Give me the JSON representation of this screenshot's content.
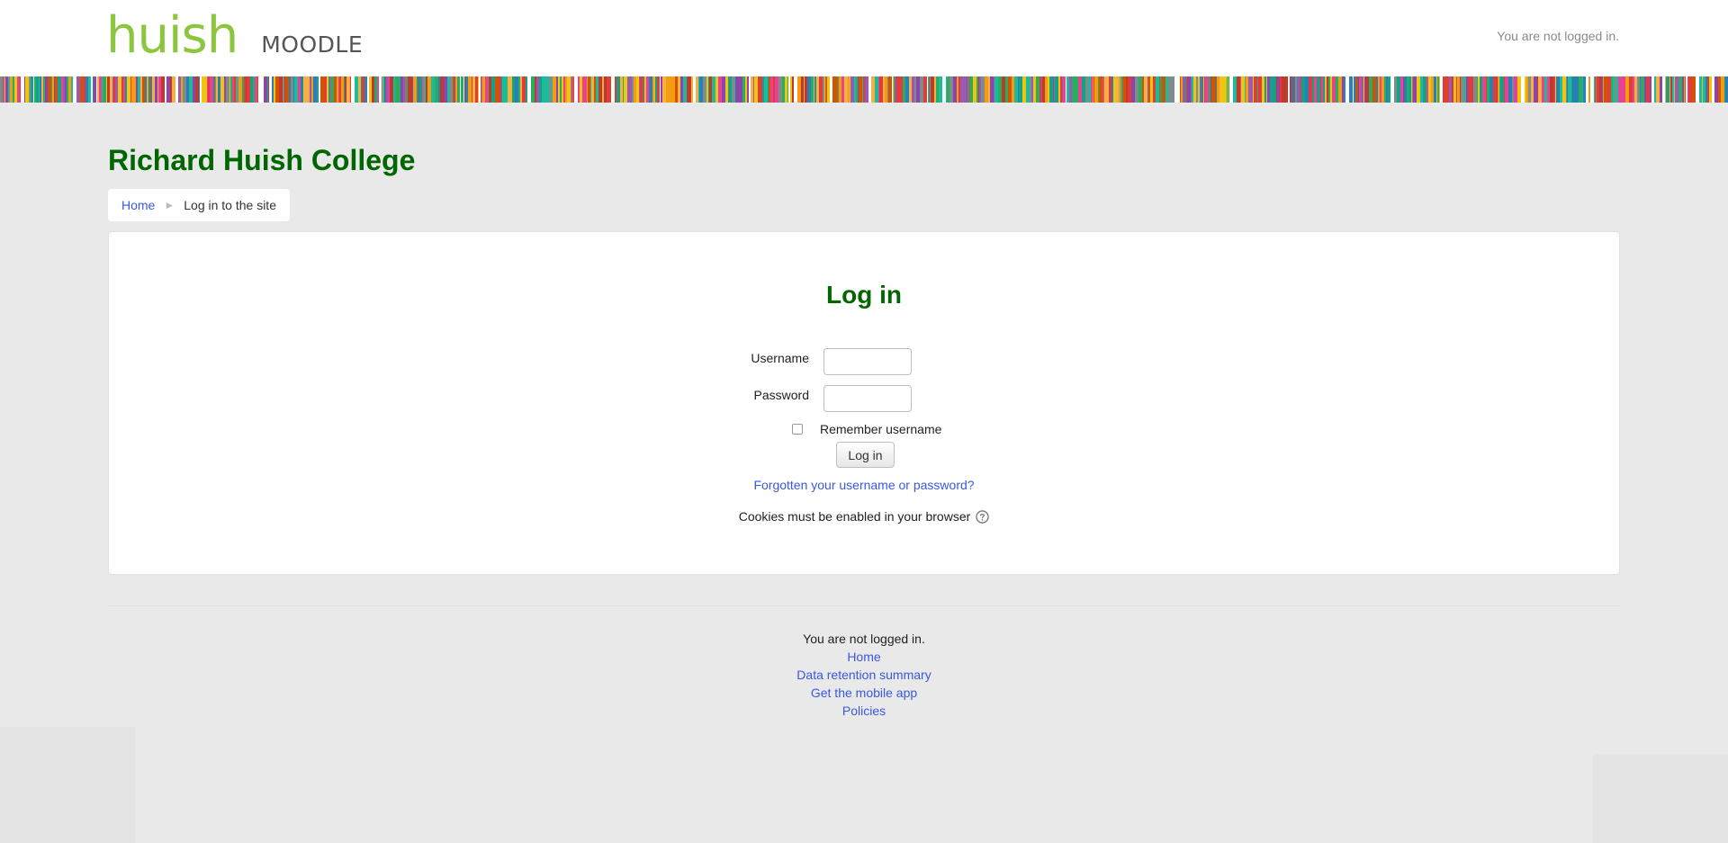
{
  "header": {
    "logo_primary": "huish",
    "logo_secondary": "MOODLE",
    "login_status": "You are not logged in.",
    "stripe_colors": [
      "#e23b3b",
      "#f39c12",
      "#f1c40f",
      "#27ae60",
      "#16a085",
      "#2980b9",
      "#8e44ad",
      "#e84393",
      "#7f8c8d",
      "#d35400",
      "#c0392b",
      "#1abc9c",
      "#9b59b6",
      "#f5b041",
      "#ffffff"
    ]
  },
  "page": {
    "title": "Richard Huish College",
    "breadcrumb": {
      "home": "Home",
      "separator": "►",
      "current": "Log in to the site"
    }
  },
  "login": {
    "title": "Log in",
    "username_label": "Username",
    "username_value": "",
    "password_label": "Password",
    "password_value": "",
    "remember_label": "Remember username",
    "remember_checked": false,
    "button_label": "Log in",
    "forgot_link": "Forgotten your username or password?",
    "cookies_text": "Cookies must be enabled in your browser"
  },
  "footer": {
    "status": "You are not logged in.",
    "links": [
      "Home",
      "Data retention summary",
      "Get the mobile app",
      "Policies"
    ]
  },
  "colors": {
    "brand_green": "#006600",
    "logo_green": "#8cc63f",
    "link_blue": "#3a58e0",
    "background": "#e9e9e9"
  }
}
